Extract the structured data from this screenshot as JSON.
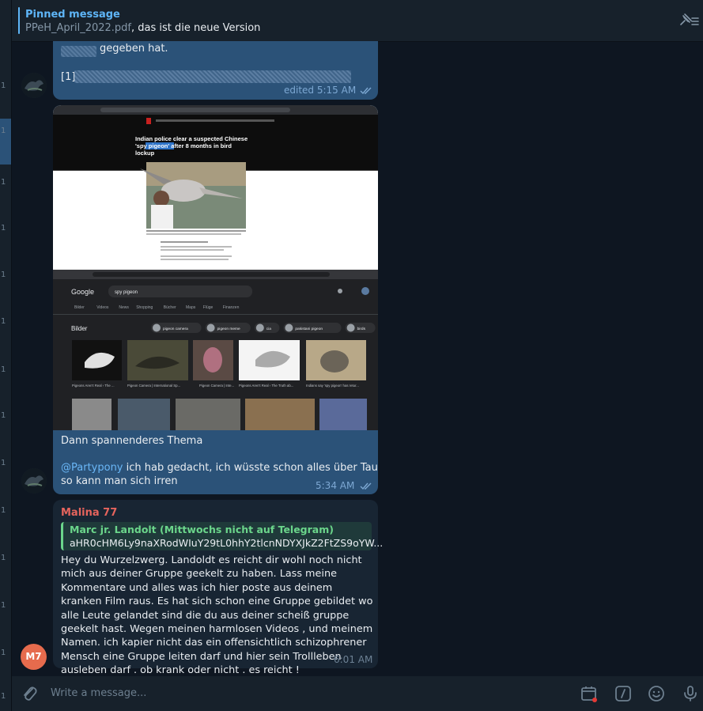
{
  "pinned": {
    "title": "Pinned message",
    "file": "PPeH_April_2022.pdf",
    "text": ", das ist die neue Version"
  },
  "messages": {
    "m1": {
      "line1": "gegeben hat.",
      "line2": "[1]",
      "time": "edited 5:15 AM"
    },
    "m2": {
      "screenshot_headline_1": "Indian police clear a suspected Chinese",
      "screenshot_headline_2": "'spy pigeon' after 8 months in bird",
      "screenshot_headline_3": "lockup",
      "screenshot_search": "spy pigeon",
      "screenshot_brand": "Google",
      "screenshot_tabs": [
        "Bilder",
        "Videos",
        "News",
        "Shopping",
        "Bücher",
        "Maps",
        "Flüge",
        "Finanzen"
      ],
      "screenshot_bilder": "Bilder",
      "screenshot_chips": [
        "pigeon camera",
        "pigeon meme",
        "cia",
        "pakistani pigeon",
        "birds",
        "cold war"
      ],
      "screenshot_results": [
        "Pigeons Aren't Real › The ...",
        "Pigeon Camera | International Sp...",
        "Pigeon Camera | Inte...",
        "Pigeons Aren't Real › The Truth ab...",
        "Indians say 'spy pigeon' has retur..."
      ],
      "caption_line1": "Dann spannenderes Thema",
      "mention": "@Partypony",
      "caption_line2": " ich hab gedacht, ich wüsste schon alles über Tauben ...",
      "caption_line3": "so kann man sich irren",
      "time": "5:34 AM"
    },
    "m3": {
      "sender": "Malina 77",
      "reply_name": "Marc jr. Landolt (Mittwochs nicht auf Telegram)",
      "reply_text": "aHR0cHM6Ly9naXRodWIuY29tL0hhY2tlcnNDYXJkZ2FtZS9oYW...",
      "body": "Hey du Wurzelzwerg. Landoldt es reicht dir wohl noch nicht mich aus deiner Gruppe geekelt zu haben. Lass meine Kommentare und alles was ich hier poste aus deinem kranken Film raus. Es hat sich schon eine Gruppe gebildet wo alle Leute gelandet sind die du aus deiner scheiß gruppe geekelt hast. Wegen meinen harmlosen Videos , und meinem Namen. ich kapier nicht das ein offensichtlich schizophrener Mensch eine Gruppe leiten darf und hier sein Trollleben ausleben darf . ob krank oder nicht . es reicht !",
      "time": "6:01 AM",
      "avatar_initials": "M7"
    }
  },
  "composer": {
    "placeholder": "Write a message..."
  },
  "colors": {
    "background": "#0e1621",
    "outgoing_bubble": "#2b5278",
    "incoming_bubble": "#182533",
    "accent": "#5eb5f7",
    "sender_name": "#e6645d",
    "reply_name": "#6bd68b"
  },
  "icons": [
    "pin-list-icon",
    "read-checks-icon",
    "attach-icon",
    "schedule-icon",
    "bot-command-icon",
    "emoji-icon",
    "microphone-icon"
  ]
}
